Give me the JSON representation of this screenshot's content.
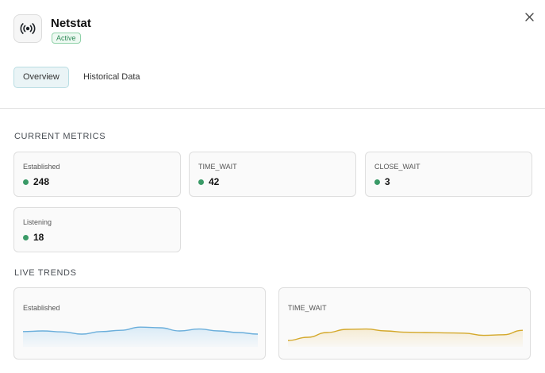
{
  "header": {
    "title": "Netstat",
    "status_badge": "Active",
    "app_icon": "broadcast-icon",
    "close_icon": "close-icon"
  },
  "tabs": [
    {
      "label": "Overview",
      "active": true
    },
    {
      "label": "Historical Data",
      "active": false
    }
  ],
  "current_metrics": {
    "title": "CURRENT METRICS",
    "items": [
      {
        "label": "Established",
        "value": "248",
        "status_color": "#3a9a67"
      },
      {
        "label": "TIME_WAIT",
        "value": "42",
        "status_color": "#3a9a67"
      },
      {
        "label": "CLOSE_WAIT",
        "value": "3",
        "status_color": "#3a9a67"
      },
      {
        "label": "Listening",
        "value": "18",
        "status_color": "#3a9a67"
      }
    ]
  },
  "live_trends": {
    "title": "LIVE TRENDS",
    "charts": [
      {
        "label": "Established",
        "color": "#6aaedb",
        "fill": "#d6e9f6",
        "values": [
          0.48,
          0.5,
          0.47,
          0.4,
          0.48,
          0.52,
          0.62,
          0.6,
          0.5,
          0.56,
          0.5,
          0.45,
          0.4
        ]
      },
      {
        "label": "TIME_WAIT",
        "color": "#d4a82a",
        "fill": "#f5ead0",
        "values": [
          0.2,
          0.3,
          0.45,
          0.55,
          0.56,
          0.5,
          0.46,
          0.45,
          0.44,
          0.43,
          0.36,
          0.38,
          0.52
        ]
      }
    ]
  },
  "colors": {
    "accent": "#eaf4f6",
    "accent_border": "#b9dde3",
    "status_green": "#3a9a67"
  }
}
